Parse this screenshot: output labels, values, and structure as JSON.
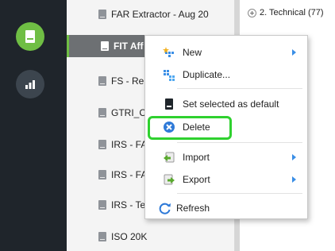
{
  "colors": {
    "rail_bg": "#1f252b",
    "rail_active": "#6fbe44",
    "selected_row": "#6d7073",
    "highlight": "#2fd12f",
    "accent_blue": "#3a8ee6"
  },
  "rail": {
    "items": [
      {
        "icon": "document-icon"
      },
      {
        "icon": "bar-chart-icon"
      }
    ]
  },
  "list": {
    "items": [
      {
        "label": "FAR Extractor - Aug 20"
      },
      {
        "label": "FIT Aff"
      },
      {
        "label": "FS - Re"
      },
      {
        "label": "GTRI_C"
      },
      {
        "label": "IRS - FA"
      },
      {
        "label": "IRS - FA"
      },
      {
        "label": "IRS - Te"
      },
      {
        "label": "ISO 20K"
      }
    ]
  },
  "tree": {
    "node_label": "2. Technical (77)"
  },
  "context_menu": {
    "items": [
      {
        "label": "New",
        "icon": "new-icon",
        "submenu": true
      },
      {
        "label": "Duplicate...",
        "icon": "duplicate-icon",
        "submenu": false
      },
      {
        "label": "Set selected as default",
        "icon": "default-icon",
        "submenu": false
      },
      {
        "label": "Delete",
        "icon": "delete-icon",
        "submenu": false
      },
      {
        "label": "Import",
        "icon": "import-icon",
        "submenu": true
      },
      {
        "label": "Export",
        "icon": "export-icon",
        "submenu": true
      },
      {
        "label": "Refresh",
        "icon": "refresh-icon",
        "submenu": false
      }
    ]
  }
}
